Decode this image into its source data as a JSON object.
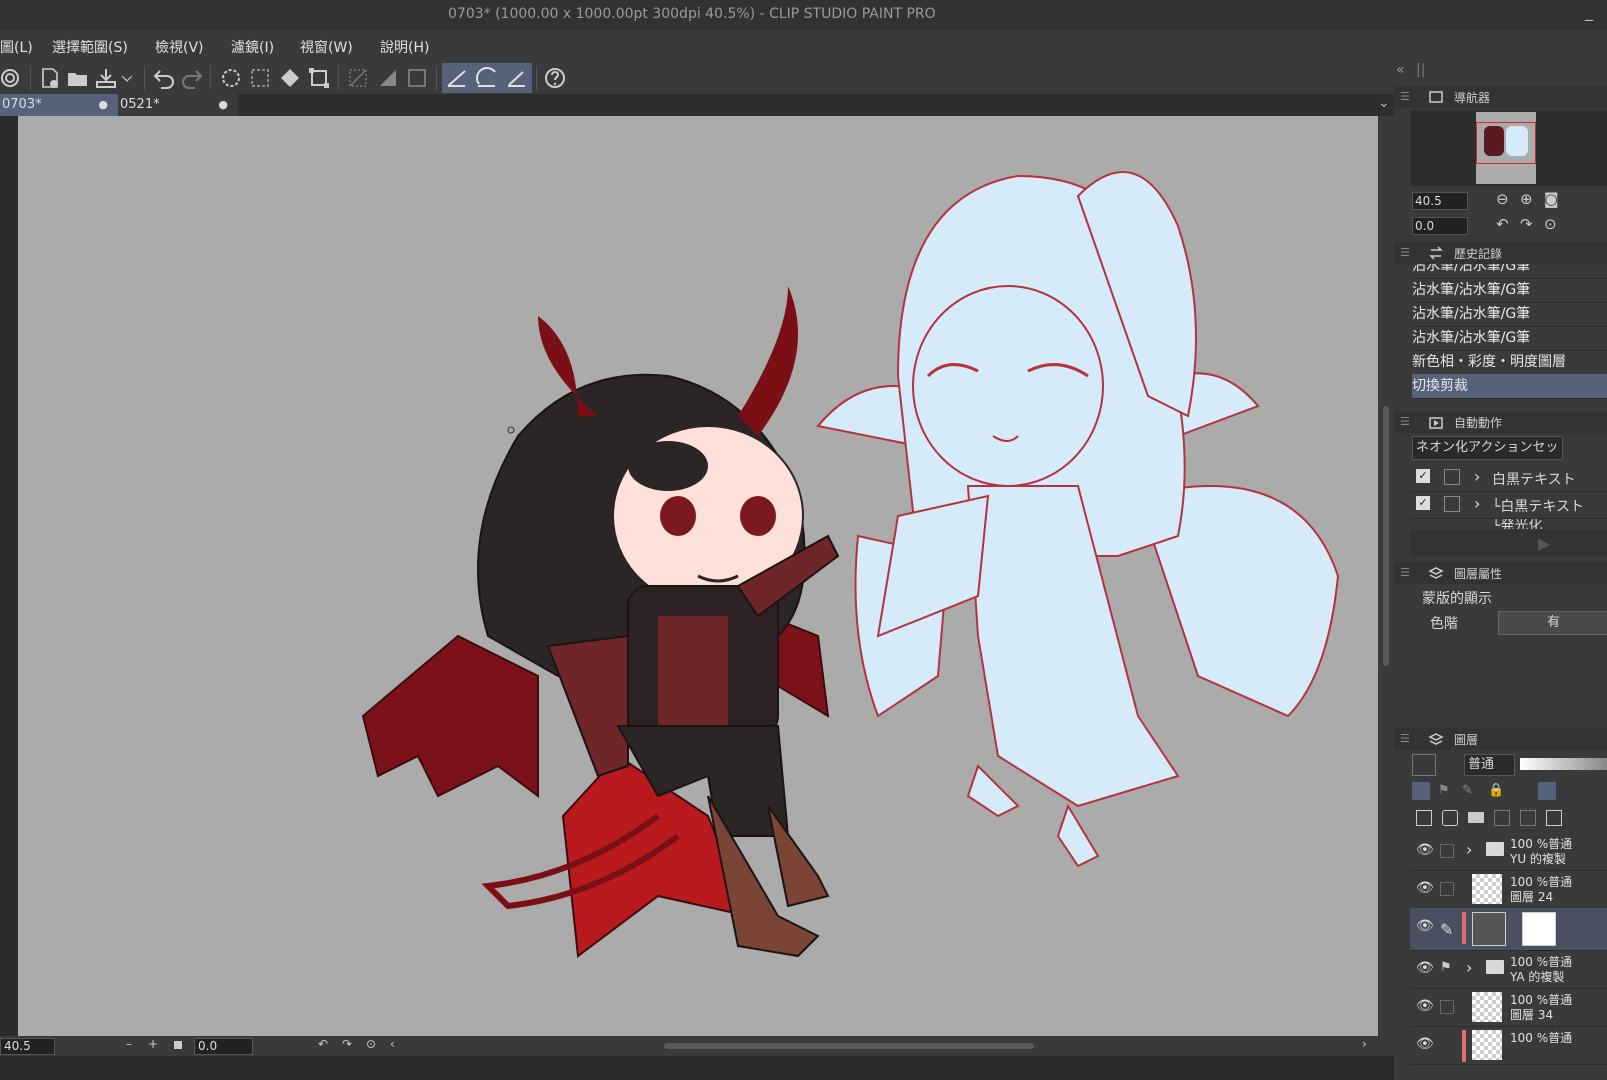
{
  "window": {
    "title": "0703* (1000.00 x 1000.00pt 300dpi 40.5%)  - CLIP STUDIO PAINT PRO",
    "minimize": "_"
  },
  "menu": [
    "圖(L)",
    "選擇範圍(S)",
    "檢視(V)",
    "濾鏡(I)",
    "視窗(W)",
    "說明(H)"
  ],
  "toolbar": {
    "icons": [
      "clip-studio-icon",
      "new-file-icon",
      "open-file-icon",
      "save-icon",
      "dropdown-icon",
      "undo-icon",
      "redo-icon",
      "deselect-icon",
      "select-all-icon",
      "fill-icon",
      "transform-icon",
      "clear-icon",
      "fill-selection-icon",
      "show-selection-icon",
      "ruler-snap-icon",
      "special-ruler-icon",
      "grid-snap-icon",
      "help-icon"
    ]
  },
  "tabs": [
    {
      "label": "0703*",
      "modified": "●",
      "active": true
    },
    {
      "label": "0521*",
      "modified": "●",
      "active": false
    }
  ],
  "tab_overflow": "⌄",
  "status": {
    "zoom": "40.5",
    "minus": "–",
    "plus": "+",
    "rotation": "0.0"
  },
  "navigator": {
    "title": "導航器",
    "zoom": "40.5",
    "rotation": "0.0"
  },
  "history": {
    "title": "歷史記錄",
    "items": [
      "沾水筆/沾水筆/G筆",
      "沾水筆/沾水筆/G筆",
      "沾水筆/沾水筆/G筆",
      "沾水筆/沾水筆/G筆",
      "新色相・彩度・明度圖層",
      "切換剪裁"
    ],
    "selected_index": 5
  },
  "auto_action": {
    "title": "自動動作",
    "set": "ネオン化アクションセット",
    "items": [
      "白黒テキスト",
      "└白黒テキスト",
      "└発光化"
    ]
  },
  "layer_property": {
    "title": "圖層屬性",
    "section": "蒙版的顯示",
    "label": "色階",
    "value": "有"
  },
  "layers": {
    "title": "圖層",
    "blend_mode": "普通",
    "rows": [
      {
        "opacity": "100 %普通",
        "name": "YU 的複製",
        "kind": "folder"
      },
      {
        "opacity": "100 %普通",
        "name": "圖層 24",
        "kind": "raster"
      },
      {
        "opacity": "",
        "name": "",
        "kind": "adjust"
      },
      {
        "opacity": "100 %普通",
        "name": "YA 的複製",
        "kind": "folder"
      },
      {
        "opacity": "100 %普通",
        "name": "圖層 34",
        "kind": "raster"
      },
      {
        "opacity": "100 %普通",
        "name": "",
        "kind": "raster"
      }
    ]
  },
  "colors": {
    "accent": "#56617a",
    "canvas_bg": "#ababab",
    "line_red": "#b5333d"
  }
}
